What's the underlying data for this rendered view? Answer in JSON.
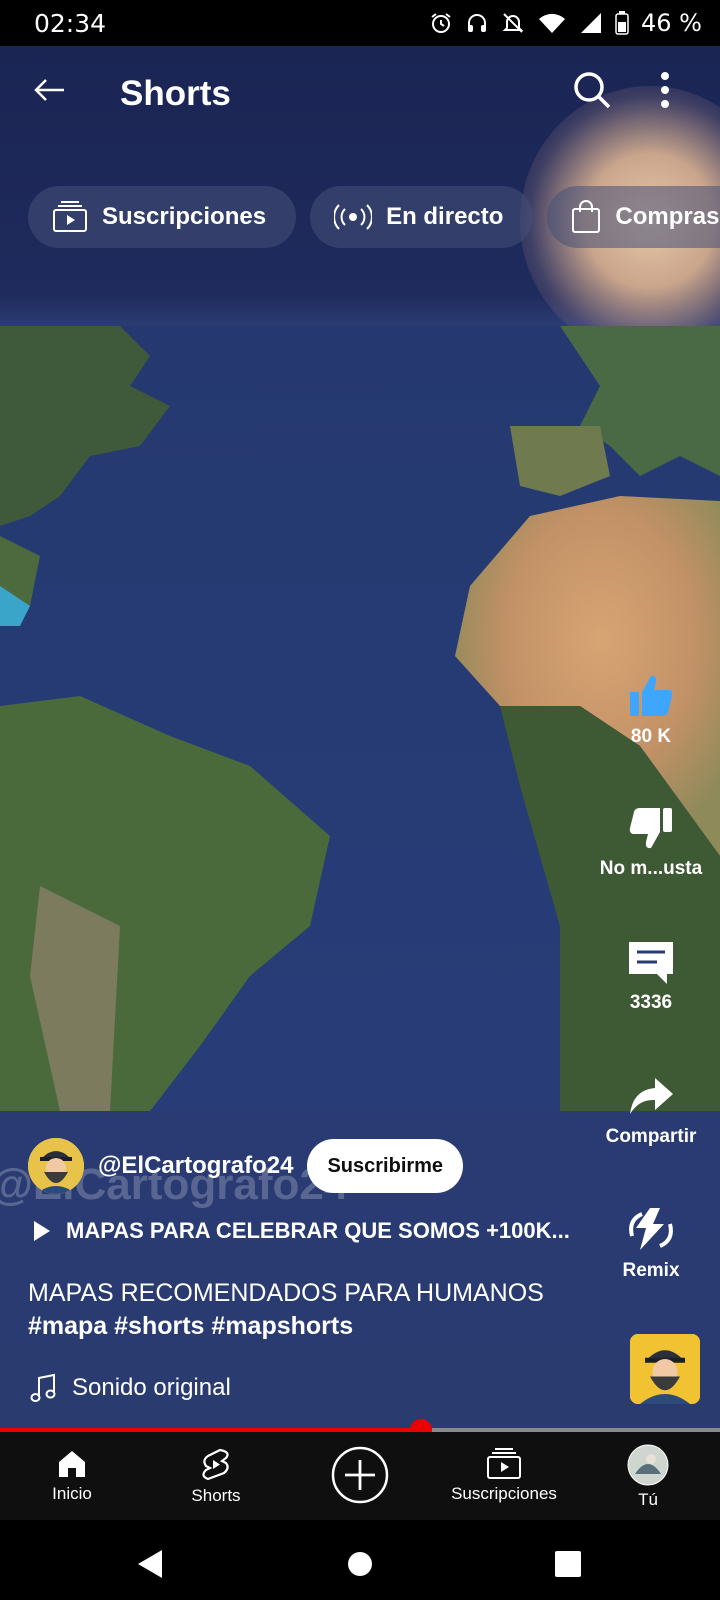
{
  "status": {
    "time": "02:34",
    "battery": "46 %"
  },
  "appbar": {
    "title": "Shorts"
  },
  "chips": [
    {
      "label": "Suscripciones",
      "icon": "subscriptions-icon"
    },
    {
      "label": "En directo",
      "icon": "live-icon"
    },
    {
      "label": "Compras",
      "icon": "shopping-bag-icon"
    }
  ],
  "actions": {
    "like": {
      "label": "80 K",
      "icon": "thumbs-up-icon"
    },
    "dislike": {
      "label": "No m...usta",
      "icon": "thumbs-down-icon"
    },
    "comments": {
      "label": "3336",
      "icon": "comment-icon"
    },
    "share": {
      "label": "Compartir",
      "icon": "share-icon"
    },
    "remix": {
      "label": "Remix",
      "icon": "remix-icon"
    }
  },
  "video": {
    "channel_handle": "@ElCartografo24",
    "watermark": "@ElCartografo24",
    "subscribe_label": "Suscribirme",
    "playlist_title": "MAPAS PARA CELEBRAR QUE SOMOS +100K...",
    "description": "MAPAS RECOMENDADOS PARA HUMANOS",
    "hashtags": "#mapa #shorts #mapshorts",
    "sound": "Sonido original",
    "progress": 0.585
  },
  "bottom_nav": [
    {
      "label": "Inicio",
      "icon": "home-icon"
    },
    {
      "label": "Shorts",
      "icon": "shorts-icon"
    },
    {
      "label": "",
      "icon": "create-plus-icon"
    },
    {
      "label": "Suscripciones",
      "icon": "subscriptions-icon"
    },
    {
      "label": "Tú",
      "icon": "profile-avatar-icon"
    }
  ],
  "colors": {
    "accent": "#ff0000",
    "like": "#3ea6ff",
    "background": "#0f0f0f"
  }
}
